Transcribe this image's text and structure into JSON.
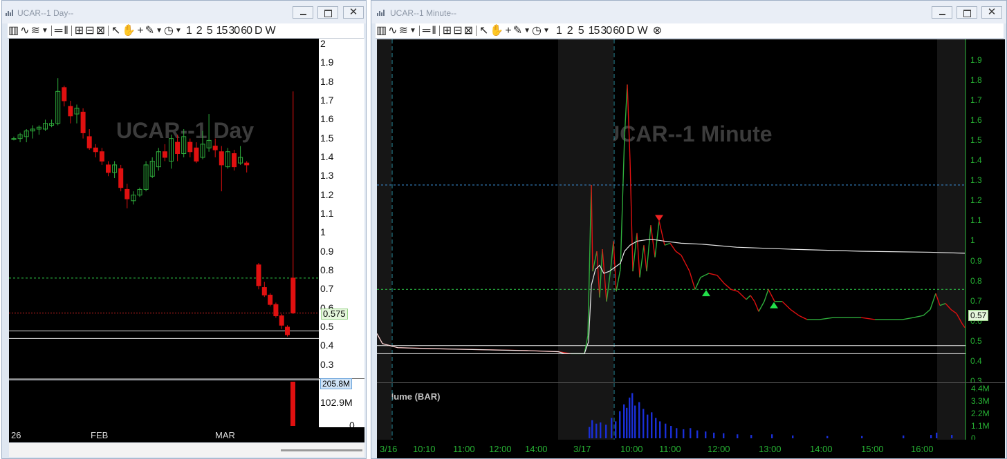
{
  "left_window": {
    "title": "UCAR--1 Day--",
    "chart_label": "UCAR--1 Day",
    "price_tag": "0.575",
    "volume_tag": "205.8M",
    "price_ticks": [
      "2",
      "1.9",
      "1.8",
      "1.7",
      "1.6",
      "1.5",
      "1.4",
      "1.3",
      "1.2",
      "1.1",
      "1",
      "0.9",
      "0.8",
      "0.7",
      "0.6",
      "0.5",
      "0.4",
      "0.3"
    ],
    "volume_ticks": [
      "102.9M",
      "0"
    ],
    "date_ticks": [
      "26",
      "FEB",
      "MAR"
    ]
  },
  "right_window": {
    "title": "UCAR--1 Minute--",
    "chart_label": "UCAR--1 Minute",
    "price_tag": "0.57",
    "volume_title": "Volume (BAR)",
    "price_ticks": [
      "1.9",
      "1.8",
      "1.7",
      "1.6",
      "1.5",
      "1.4",
      "1.3",
      "1.2",
      "1.1",
      "1",
      "0.9",
      "0.8",
      "0.7",
      "0.6",
      "0.5",
      "0.4",
      "0.3"
    ],
    "volume_ticks": [
      "4.4M",
      "3.3M",
      "2.2M",
      "1.1M",
      "0"
    ],
    "time_ticks": [
      "3/16",
      "10:10",
      "11:00",
      "12:00",
      "14:00",
      "3/17",
      "10:00",
      "11:00",
      "12:00",
      "13:00",
      "14:00",
      "15:00",
      "16:00"
    ]
  },
  "toolbar": {
    "timeframes": [
      "1",
      "2",
      "5",
      "15",
      "30",
      "60",
      "D",
      "W"
    ]
  },
  "colors": {
    "up_candle": "#2fae3c",
    "down_candle": "#e01010",
    "green_level": "#2fd04a",
    "blue_level": "#3a8fd8",
    "vwap": "#e8e8e8",
    "volume": "#1a2fd6"
  },
  "chart_data": [
    {
      "type": "candlestick",
      "title": "UCAR--1 Day",
      "x_ticks": [
        "26",
        "FEB",
        "MAR"
      ],
      "ylim": [
        0.25,
        2.0
      ],
      "levels": [
        0.76,
        0.575,
        0.48,
        0.44
      ],
      "candles": [
        {
          "o": 1.5,
          "h": 1.51,
          "l": 1.49,
          "c": 1.5
        },
        {
          "o": 1.5,
          "h": 1.53,
          "l": 1.48,
          "c": 1.52
        },
        {
          "o": 1.51,
          "h": 1.55,
          "l": 1.48,
          "c": 1.54
        },
        {
          "o": 1.54,
          "h": 1.57,
          "l": 1.5,
          "c": 1.55
        },
        {
          "o": 1.55,
          "h": 1.57,
          "l": 1.52,
          "c": 1.56
        },
        {
          "o": 1.55,
          "h": 1.6,
          "l": 1.54,
          "c": 1.58
        },
        {
          "o": 1.57,
          "h": 1.6,
          "l": 1.56,
          "c": 1.58
        },
        {
          "o": 1.58,
          "h": 1.82,
          "l": 1.57,
          "c": 1.75
        },
        {
          "o": 1.77,
          "h": 1.78,
          "l": 1.67,
          "c": 1.7
        },
        {
          "o": 1.67,
          "h": 1.7,
          "l": 1.58,
          "c": 1.62
        },
        {
          "o": 1.63,
          "h": 1.68,
          "l": 1.58,
          "c": 1.66
        },
        {
          "o": 1.64,
          "h": 1.66,
          "l": 1.5,
          "c": 1.53
        },
        {
          "o": 1.51,
          "h": 1.55,
          "l": 1.44,
          "c": 1.45
        },
        {
          "o": 1.45,
          "h": 1.47,
          "l": 1.4,
          "c": 1.43
        },
        {
          "o": 1.43,
          "h": 1.45,
          "l": 1.36,
          "c": 1.38
        },
        {
          "o": 1.36,
          "h": 1.38,
          "l": 1.3,
          "c": 1.32
        },
        {
          "o": 1.32,
          "h": 1.38,
          "l": 1.29,
          "c": 1.36
        },
        {
          "o": 1.34,
          "h": 1.36,
          "l": 1.22,
          "c": 1.24
        },
        {
          "o": 1.23,
          "h": 1.26,
          "l": 1.13,
          "c": 1.18
        },
        {
          "o": 1.17,
          "h": 1.22,
          "l": 1.15,
          "c": 1.2
        },
        {
          "o": 1.2,
          "h": 1.24,
          "l": 1.19,
          "c": 1.23
        },
        {
          "o": 1.23,
          "h": 1.38,
          "l": 1.22,
          "c": 1.36
        },
        {
          "o": 1.3,
          "h": 1.4,
          "l": 1.29,
          "c": 1.38
        },
        {
          "o": 1.35,
          "h": 1.45,
          "l": 1.33,
          "c": 1.43
        },
        {
          "o": 1.43,
          "h": 1.47,
          "l": 1.38,
          "c": 1.4
        },
        {
          "o": 1.38,
          "h": 1.52,
          "l": 1.34,
          "c": 1.5
        },
        {
          "o": 1.48,
          "h": 1.52,
          "l": 1.38,
          "c": 1.42
        },
        {
          "o": 1.42,
          "h": 1.55,
          "l": 1.4,
          "c": 1.51
        },
        {
          "o": 1.48,
          "h": 1.5,
          "l": 1.4,
          "c": 1.43
        },
        {
          "o": 1.45,
          "h": 1.48,
          "l": 1.37,
          "c": 1.38
        },
        {
          "o": 1.4,
          "h": 1.54,
          "l": 1.39,
          "c": 1.47
        },
        {
          "o": 1.45,
          "h": 1.63,
          "l": 1.43,
          "c": 1.49
        },
        {
          "o": 1.46,
          "h": 1.5,
          "l": 1.4,
          "c": 1.44
        },
        {
          "o": 1.43,
          "h": 1.46,
          "l": 1.22,
          "c": 1.36
        },
        {
          "o": 1.35,
          "h": 1.45,
          "l": 1.34,
          "c": 1.43
        },
        {
          "o": 1.42,
          "h": 1.44,
          "l": 1.33,
          "c": 1.35
        },
        {
          "o": 1.37,
          "h": 1.46,
          "l": 1.36,
          "c": 1.4
        },
        {
          "o": 1.37,
          "h": 1.38,
          "l": 1.32,
          "c": 1.36
        }
      ],
      "candles_recent": [
        {
          "o": 0.83,
          "h": 0.84,
          "l": 0.7,
          "c": 0.72
        },
        {
          "o": 0.71,
          "h": 0.74,
          "l": 0.66,
          "c": 0.67
        },
        {
          "o": 0.67,
          "h": 0.68,
          "l": 0.61,
          "c": 0.62
        },
        {
          "o": 0.62,
          "h": 0.63,
          "l": 0.55,
          "c": 0.56
        },
        {
          "o": 0.56,
          "h": 0.57,
          "l": 0.49,
          "c": 0.51
        },
        {
          "o": 0.5,
          "h": 0.51,
          "l": 0.45,
          "c": 0.46
        },
        {
          "o": 0.76,
          "h": 1.75,
          "l": 0.57,
          "c": 0.575
        }
      ],
      "volume_recent": 205.8
    },
    {
      "type": "line",
      "title": "UCAR--1 Minute",
      "x_ticks": [
        "3/16",
        "10:10",
        "11:00",
        "12:00",
        "14:00",
        "3/17",
        "10:00",
        "11:00",
        "12:00",
        "13:00",
        "14:00",
        "15:00",
        "16:00"
      ],
      "ylim": [
        0.25,
        1.95
      ],
      "levels": {
        "blue": 1.28,
        "green": 0.76,
        "white": [
          0.48,
          0.44
        ]
      },
      "price": [
        [
          0,
          0.54
        ],
        [
          8,
          0.49
        ],
        [
          30,
          0.47
        ],
        [
          80,
          0.465
        ],
        [
          150,
          0.46
        ],
        [
          220,
          0.455
        ],
        [
          262,
          0.45
        ],
        [
          280,
          0.44
        ],
        [
          290,
          0.44
        ],
        [
          300,
          0.44
        ],
        [
          305,
          0.53
        ],
        [
          310,
          1.28
        ],
        [
          312,
          0.85
        ],
        [
          318,
          0.95
        ],
        [
          322,
          0.72
        ],
        [
          326,
          0.96
        ],
        [
          332,
          0.7
        ],
        [
          338,
          0.86
        ],
        [
          342,
          1.0
        ],
        [
          346,
          0.75
        ],
        [
          352,
          0.86
        ],
        [
          358,
          1.52
        ],
        [
          362,
          1.78
        ],
        [
          366,
          1.4
        ],
        [
          370,
          0.85
        ],
        [
          376,
          1.04
        ],
        [
          380,
          0.82
        ],
        [
          386,
          0.98
        ],
        [
          390,
          0.85
        ],
        [
          396,
          1.08
        ],
        [
          402,
          0.92
        ],
        [
          408,
          1.1
        ],
        [
          416,
          0.98
        ],
        [
          424,
          0.99
        ],
        [
          432,
          0.95
        ],
        [
          440,
          0.93
        ],
        [
          452,
          0.85
        ],
        [
          460,
          0.76
        ],
        [
          468,
          0.82
        ],
        [
          480,
          0.84
        ],
        [
          492,
          0.83
        ],
        [
          502,
          0.79
        ],
        [
          512,
          0.76
        ],
        [
          522,
          0.75
        ],
        [
          534,
          0.71
        ],
        [
          540,
          0.73
        ],
        [
          546,
          0.7
        ],
        [
          552,
          0.65
        ],
        [
          560,
          0.7
        ],
        [
          566,
          0.76
        ],
        [
          575,
          0.7
        ],
        [
          586,
          0.7
        ],
        [
          598,
          0.66
        ],
        [
          610,
          0.63
        ],
        [
          622,
          0.61
        ],
        [
          640,
          0.61
        ],
        [
          660,
          0.62
        ],
        [
          680,
          0.62
        ],
        [
          700,
          0.62
        ],
        [
          720,
          0.61
        ],
        [
          740,
          0.61
        ],
        [
          760,
          0.61
        ],
        [
          776,
          0.62
        ],
        [
          790,
          0.63
        ],
        [
          800,
          0.66
        ],
        [
          808,
          0.74
        ],
        [
          814,
          0.68
        ],
        [
          822,
          0.69
        ],
        [
          830,
          0.66
        ],
        [
          838,
          0.64
        ],
        [
          846,
          0.59
        ],
        [
          850,
          0.57
        ]
      ],
      "vwap": [
        [
          0,
          0.54
        ],
        [
          8,
          0.49
        ],
        [
          30,
          0.47
        ],
        [
          80,
          0.465
        ],
        [
          150,
          0.46
        ],
        [
          220,
          0.455
        ],
        [
          262,
          0.45
        ],
        [
          272,
          0.44
        ],
        [
          290,
          0.44
        ],
        [
          300,
          0.44
        ],
        [
          306,
          0.5
        ],
        [
          310,
          0.78
        ],
        [
          316,
          0.86
        ],
        [
          322,
          0.88
        ],
        [
          328,
          0.84
        ],
        [
          336,
          0.85
        ],
        [
          344,
          0.87
        ],
        [
          352,
          0.89
        ],
        [
          358,
          0.95
        ],
        [
          366,
          0.98
        ],
        [
          376,
          1.0
        ],
        [
          396,
          1.01
        ],
        [
          416,
          1.0
        ],
        [
          440,
          0.99
        ],
        [
          470,
          0.985
        ],
        [
          520,
          0.97
        ],
        [
          600,
          0.96
        ],
        [
          700,
          0.95
        ],
        [
          800,
          0.945
        ],
        [
          850,
          0.94
        ]
      ],
      "signals": [
        {
          "type": "sell",
          "x": 408,
          "y": 1.11
        },
        {
          "type": "buy",
          "x": 476,
          "y": 0.74
        },
        {
          "type": "buy",
          "x": 574,
          "y": 0.68
        }
      ],
      "volume_peaks": [
        [
          306,
          1.0
        ],
        [
          310,
          1.6
        ],
        [
          316,
          1.3
        ],
        [
          322,
          1.4
        ],
        [
          330,
          1.2
        ],
        [
          338,
          1.8
        ],
        [
          344,
          1.5
        ],
        [
          350,
          2.4
        ],
        [
          356,
          3.0
        ],
        [
          360,
          2.7
        ],
        [
          364,
          3.6
        ],
        [
          368,
          4.0
        ],
        [
          372,
          2.9
        ],
        [
          378,
          3.2
        ],
        [
          384,
          2.6
        ],
        [
          390,
          2.1
        ],
        [
          396,
          2.3
        ],
        [
          402,
          1.8
        ],
        [
          408,
          1.5
        ],
        [
          416,
          1.3
        ],
        [
          424,
          1.1
        ],
        [
          432,
          0.9
        ],
        [
          442,
          0.8
        ],
        [
          452,
          0.9
        ],
        [
          462,
          0.7
        ],
        [
          474,
          0.6
        ],
        [
          486,
          0.5
        ],
        [
          500,
          0.45
        ],
        [
          520,
          0.35
        ],
        [
          540,
          0.3
        ],
        [
          570,
          0.35
        ],
        [
          600,
          0.25
        ],
        [
          650,
          0.2
        ],
        [
          700,
          0.2
        ],
        [
          760,
          0.25
        ],
        [
          800,
          0.3
        ],
        [
          808,
          0.5
        ],
        [
          830,
          0.3
        ]
      ]
    }
  ]
}
